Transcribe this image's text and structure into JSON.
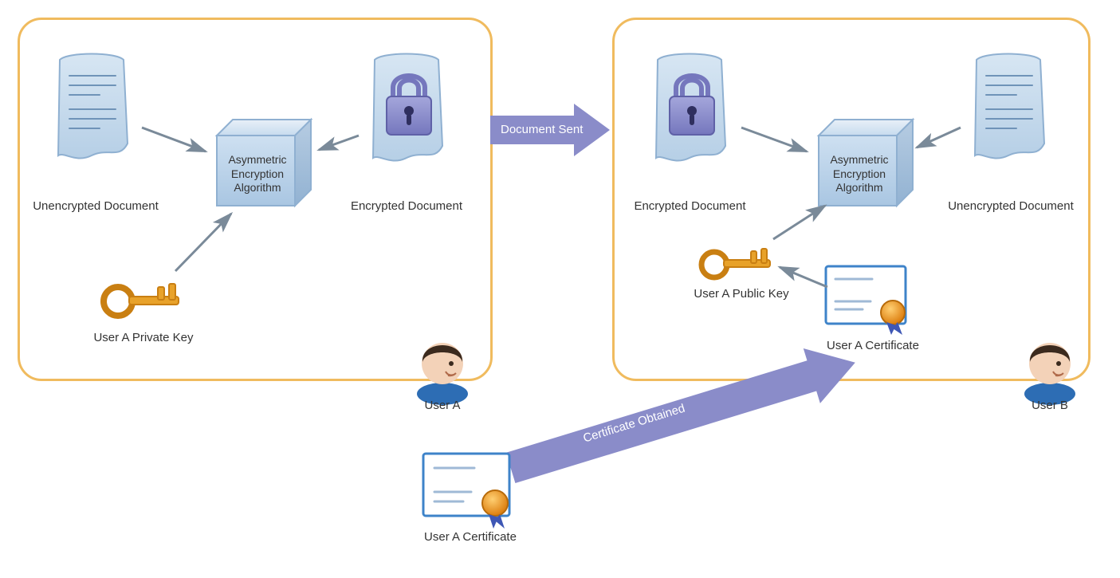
{
  "panels": {
    "left": "User A",
    "right": "User B"
  },
  "labels": {
    "unencrypted_doc": "Unencrypted Document",
    "encrypted_doc": "Encrypted Document",
    "algo": "Asymmetric\nEncryption\nAlgorithm",
    "user_a_private_key": "User A Private Key",
    "user_a_public_key": "User A Public Key",
    "user_a_certificate": "User A Certificate"
  },
  "arrows": {
    "document_sent": "Document Sent",
    "certificate_obtained": "Certificate Obtained"
  },
  "colors": {
    "panel_border": "#f0bb5e",
    "doc_fill": "#c2d7eb",
    "doc_stroke": "#8fb0d1",
    "cube_fill": "#c2d7eb",
    "cube_stroke": "#8fb0d1",
    "lock_fill": "#8a8cc9",
    "key_fill": "#e8a22a",
    "cert_border": "#3e83c9",
    "arrow_thin": "#7a8a99",
    "arrow_block": "#8a8cc9",
    "user_hair": "#3b2a1e",
    "user_skin": "#f3d2b8",
    "user_shirt": "#2d6db4",
    "seal_orange": "#e99024",
    "seal_ribbon": "#3e57b5"
  }
}
